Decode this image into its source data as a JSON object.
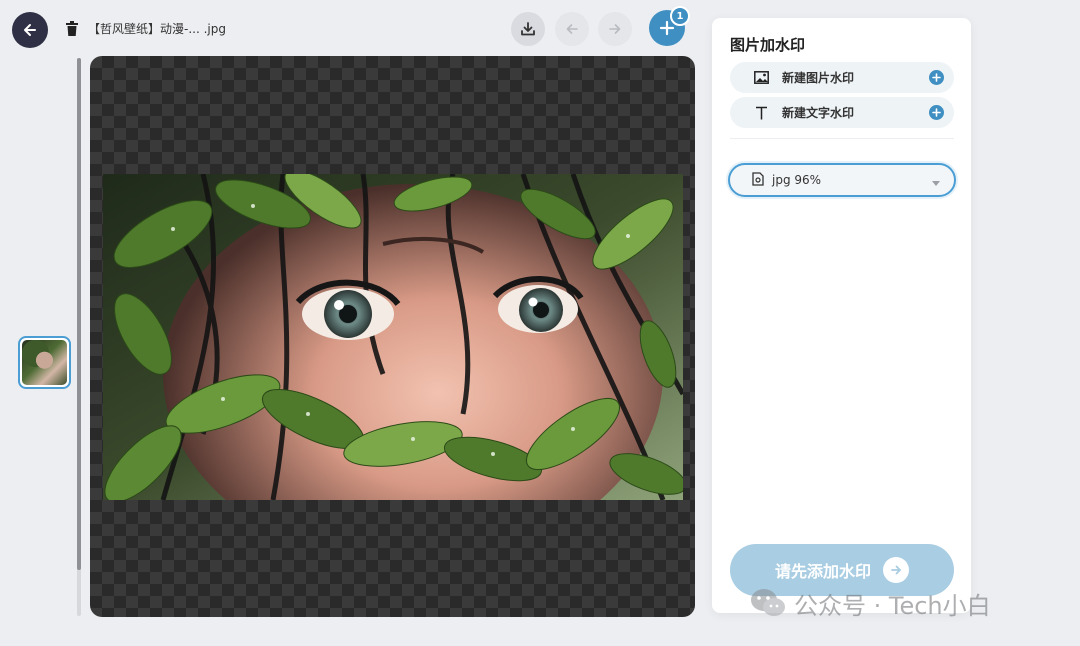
{
  "toolbar": {
    "file_name": "【哲风壁纸】动漫-... .jpg",
    "add_badge_count": "1",
    "icons": {
      "back": "arrow-left-icon",
      "delete": "trash-icon",
      "download": "download-icon",
      "undo": "arrow-left-icon",
      "redo": "arrow-right-icon",
      "add": "plus-icon"
    }
  },
  "panel": {
    "title": "图片加水印",
    "add_image_label": "新建图片水印",
    "add_text_label": "新建文字水印",
    "format_value": "jpg 96%",
    "submit_label": "请先添加水印"
  },
  "overlay": {
    "text": "公众号 · Tech小白"
  },
  "colors": {
    "accent": "#3f8fc2",
    "dark_button": "#2f3045",
    "submit_disabled": "#a9cde2"
  }
}
